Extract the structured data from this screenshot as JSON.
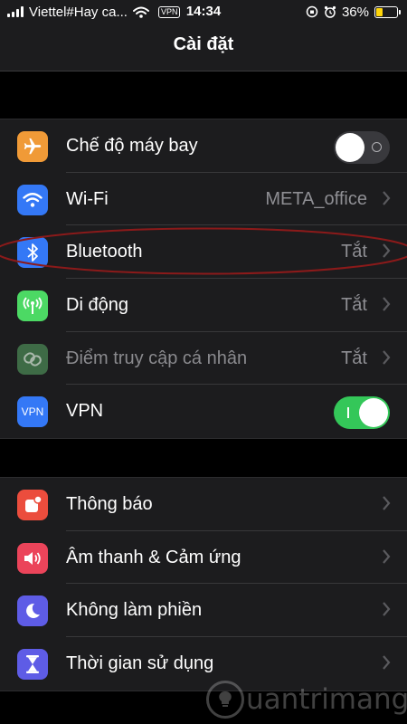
{
  "status_bar": {
    "carrier": "Viettel#Hay ca...",
    "vpn": "VPN",
    "time": "14:34",
    "battery": "36%",
    "battery_level": 0.36
  },
  "nav": {
    "title": "Cài đặt"
  },
  "groups": [
    {
      "rows": [
        {
          "label": "Chế độ máy bay",
          "toggle": "off",
          "icon": "airplane-icon",
          "icon_color": "#f09a37"
        },
        {
          "label": "Wi-Fi",
          "value": "META_office",
          "icon": "wifi-icon",
          "icon_color": "#3478f6"
        },
        {
          "label": "Bluetooth",
          "value": "Tắt",
          "icon": "bluetooth-icon",
          "icon_color": "#3478f6"
        },
        {
          "label": "Di động",
          "value": "Tắt",
          "icon": "cellular-antenna-icon",
          "icon_color": "#4cd964"
        },
        {
          "label": "Điểm truy cập cá nhân",
          "value": "Tắt",
          "icon": "hotspot-link-icon",
          "icon_color": "#3e6b46",
          "dimmed": true
        },
        {
          "label": "VPN",
          "toggle": "on",
          "icon": "vpn-icon",
          "icon_color": "#3478f6",
          "icon_text": "VPN"
        }
      ]
    },
    {
      "rows": [
        {
          "label": "Thông báo",
          "icon": "notifications-icon",
          "icon_color": "#eb4d3d"
        },
        {
          "label": "Âm thanh & Cảm ứng",
          "icon": "speaker-icon",
          "icon_color": "#eb445a"
        },
        {
          "label": "Không làm phiền",
          "icon": "moon-icon",
          "icon_color": "#5e5ce6"
        },
        {
          "label": "Thời gian sử dụng",
          "icon": "hourglass-icon",
          "icon_color": "#5e5ce6"
        }
      ]
    }
  ],
  "watermark": {
    "text": "uantrimang"
  }
}
